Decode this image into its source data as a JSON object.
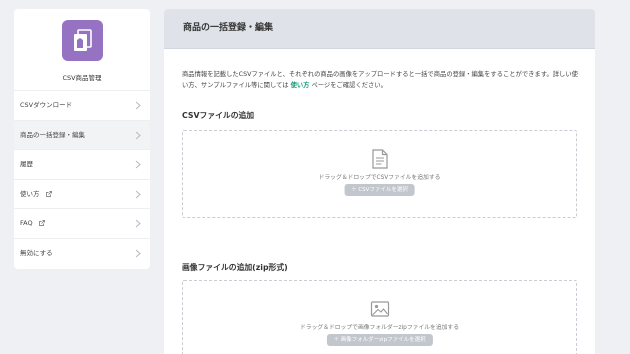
{
  "app": {
    "name": "CSV商品管理",
    "icon": "csv-product-icon",
    "accent_color": "#9673c2"
  },
  "sidebar": {
    "items": [
      {
        "label": "CSVダウンロード"
      },
      {
        "label": "商品の一括登録・編集",
        "active": true
      },
      {
        "label": "履歴"
      },
      {
        "label": "使い方",
        "external": true
      },
      {
        "label": "FAQ",
        "external": true
      },
      {
        "label": "無効にする"
      }
    ]
  },
  "main": {
    "title": "商品の一括登録・編集",
    "description_before": "商品情報を記載したCSVファイルと、それぞれの商品の画像をアップロードすると一括で商品の登録・編集をすることができます。詳しい使い方、サンプルファイル等に関しては",
    "description_link": "使い方",
    "description_after": "ページをご確認ください。",
    "link_color": "#1a9a7a",
    "csv_section": {
      "title": "CSVファイルの追加",
      "drop_text": "ドラッグ＆ドロップでCSVファイルを追加する",
      "button_label": "CSVファイルを選択",
      "icon": "document-icon"
    },
    "image_section": {
      "title": "画像ファイルの追加(zip形式)",
      "drop_text": "ドラッグ＆ドロップで画像フォルダーzipファイルを追加する",
      "button_label": "画像フォルダーzipファイルを選択",
      "icon": "image-icon"
    }
  }
}
